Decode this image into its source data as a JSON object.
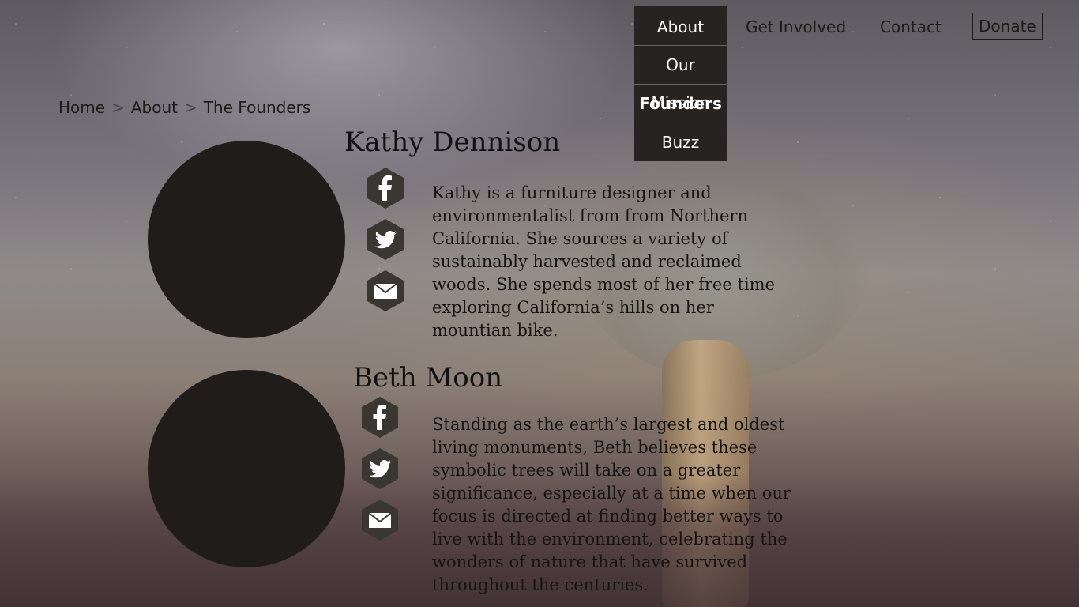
{
  "nav": {
    "about": "About",
    "get_involved": "Get Involved",
    "contact": "Contact",
    "donate": "Donate"
  },
  "dropdown": [
    "Our Mission",
    "Founders",
    "Buzz"
  ],
  "breadcrumb": {
    "home": "Home",
    "about": "About",
    "current": "The Founders",
    "separator": ">"
  },
  "founders": [
    {
      "name": "Kathy Dennison",
      "bio_lines": [
        "Kathy is a furniture designer and",
        "environmentalist from from Northern",
        "California. She sources a variety of",
        "sustainably harvested and reclaimed",
        "woods. She spends most of her free time",
        "exploring California’s hills on her",
        "mountian bike."
      ],
      "icons": [
        "facebook-icon",
        "twitter-icon",
        "email-icon"
      ]
    },
    {
      "name": "Beth Moon",
      "bio_lines": [
        "Standing as the earth’s largest and oldest",
        "living monuments, Beth believes these",
        "symbolic trees will take on a greater",
        "significance, especially at a time when our",
        "focus is directed at finding better ways to",
        "live with the environment, celebrating the",
        "wonders of nature that have survived",
        "throughout the centuries."
      ],
      "icons": [
        "facebook-icon",
        "twitter-icon",
        "email-icon"
      ]
    }
  ],
  "colors": {
    "dark_panel": "#262320",
    "text": "#1d1a18",
    "photo_placeholder": "#1f1c19",
    "hex_icon": "#3a3733"
  }
}
